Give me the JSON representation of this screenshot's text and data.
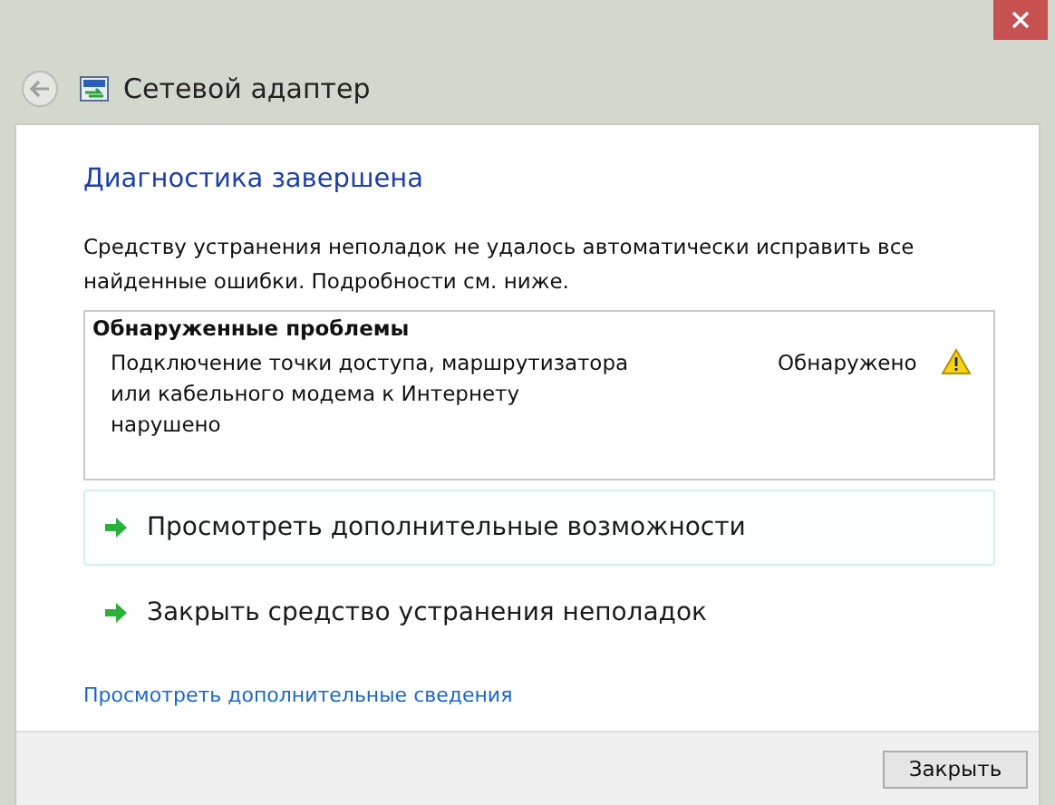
{
  "window": {
    "title": "Сетевой адаптер"
  },
  "heading": "Диагностика завершена",
  "description": "Средству устранения неполадок не удалось автоматически исправить все найденные ошибки. Подробности см. ниже.",
  "problems": {
    "title": "Обнаруженные проблемы",
    "items": [
      {
        "text": "Подключение точки доступа, маршрутизатора или кабельного модема к Интернету нарушено",
        "status": "Обнаружено",
        "kind": "warning"
      }
    ]
  },
  "options": [
    {
      "label": "Просмотреть дополнительные возможности",
      "selected": true
    },
    {
      "label": "Закрыть средство устранения неполадок",
      "selected": false
    }
  ],
  "details_link": "Просмотреть дополнительные сведения",
  "buttons": [
    "Закрыть"
  ]
}
